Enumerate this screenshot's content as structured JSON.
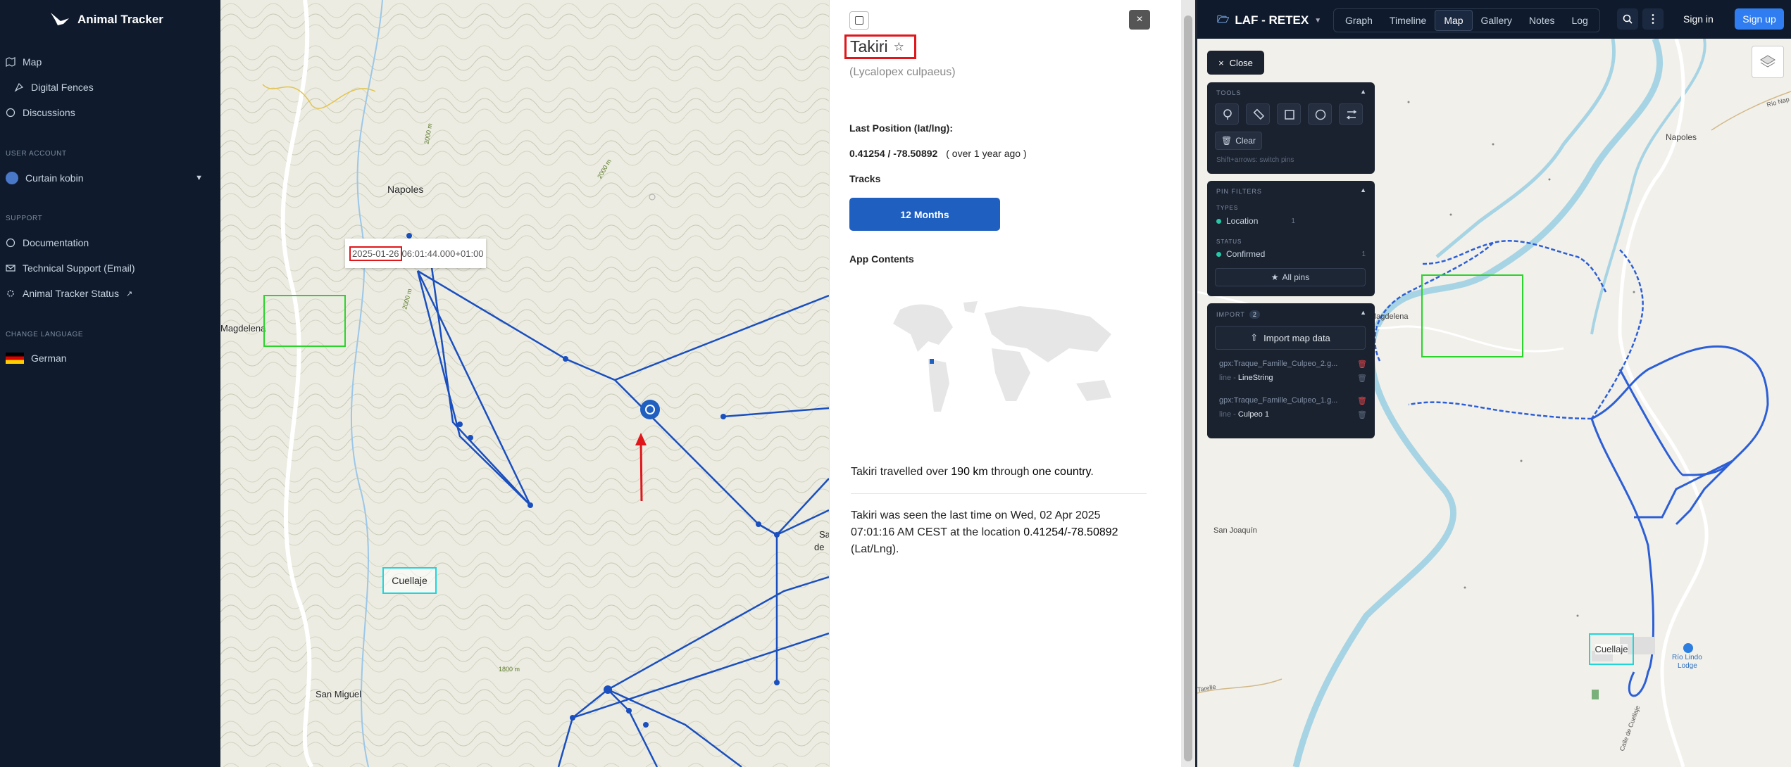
{
  "sidebar": {
    "brand": "Animal Tracker",
    "nav": [
      {
        "label": "Map",
        "icon": "map-icon"
      },
      {
        "label": "Digital Fences",
        "icon": "fence-icon"
      },
      {
        "label": "Discussions",
        "icon": "discussion-icon"
      }
    ],
    "user_section": "USER ACCOUNT",
    "user_name": "Curtain kobin",
    "support_section": "SUPPORT",
    "support_items": [
      "Documentation",
      "Technical Support (Email)",
      "Animal Tracker Status"
    ],
    "language_section": "CHANGE LANGUAGE",
    "language": "German"
  },
  "left_map": {
    "labels": {
      "napoles": "Napoles",
      "magdelena": "Magdelena",
      "cuellaje": "Cuellaje",
      "san_miguel": "San Miguel",
      "contour_2000a": "2000 m",
      "contour_2000b": "2000 m",
      "contour_2000c": "2000 m",
      "contour_1800": "1800 m",
      "edge_sa": "Sa",
      "edge_de": "de"
    },
    "tooltip_date": "2025-01-26",
    "tooltip_time": "06:01:44.000+01:00"
  },
  "detail": {
    "name": "Takiri",
    "species": "(Lycalopex culpaeus)",
    "last_position_label": "Last Position (lat/lng):",
    "last_position_value": "0.41254 / -78.50892",
    "last_position_age": "( over 1 year ago )",
    "tracks_label": "Tracks",
    "tracks_button": "12 Months",
    "app_contents_label": "App Contents",
    "summary_pre": "Takiri travelled over ",
    "summary_km": "190 km",
    "summary_mid": " through ",
    "summary_country": "one country",
    "summary_post": ".",
    "last_seen_pre": "Takiri was seen the last time on Wed, 02 Apr 2025 07:01:16 AM CEST at the location ",
    "last_seen_loc": "0.41254/-78.50892",
    "last_seen_post": " (Lat/Lng)."
  },
  "right_header": {
    "project": "LAF - RETEX",
    "tabs": [
      "Graph",
      "Timeline",
      "Map",
      "Gallery",
      "Notes",
      "Log"
    ],
    "active_tab": "Map",
    "sign_in": "Sign in",
    "sign_up": "Sign up"
  },
  "right_panel": {
    "close": "Close",
    "tools_title": "TOOLS",
    "clear": "Clear",
    "hint": "Shift+arrows: switch pins",
    "pin_filters_title": "PIN FILTERS",
    "types_label": "TYPES",
    "type_location": "Location",
    "type_location_count": "1",
    "status_label": "STATUS",
    "status_confirmed": "Confirmed",
    "status_confirmed_count": "1",
    "all_pins": "All pins",
    "import_title": "IMPORT",
    "import_count": "2",
    "import_button": "Import map data",
    "files": [
      {
        "name": "gpx:Traque_Famille_Culpeo_2.g...",
        "kind": "line - ",
        "label": "LineString"
      },
      {
        "name": "gpx:Traque_Famille_Culpeo_1.g...",
        "kind": "line - ",
        "label": "Culpeo 1"
      }
    ]
  },
  "right_map": {
    "napoles": "Napoles",
    "magdelena": "Magdelena",
    "san_joaquin": "San Joaquín",
    "cuellaje": "Cuellaje",
    "rio_lindo": "Río Lindo",
    "lodge": "Lodge",
    "road_top": "Río Nap",
    "road_left": "Tarelle",
    "road_bottom": "Calle de Cuellaje"
  },
  "colors": {
    "sidebar_bg": "#0f1b2d",
    "accent_blue": "#1f5fc0",
    "track_blue": "#1a4fbf",
    "river": "#a6d4e4",
    "highlight_red": "#e0161b",
    "highlight_green": "#2bd42b",
    "highlight_cyan": "#1fd6db"
  }
}
